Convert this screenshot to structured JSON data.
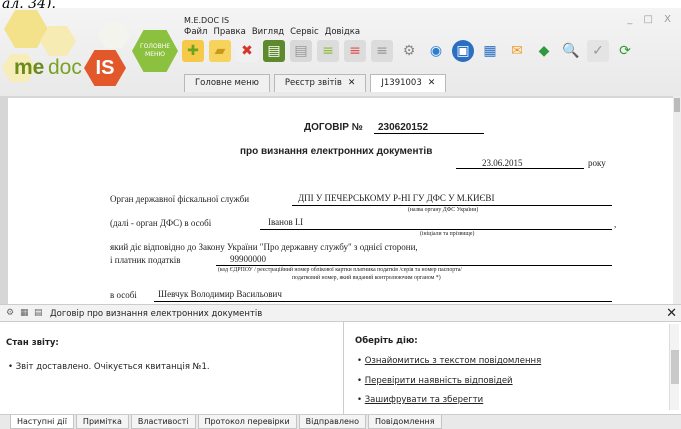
{
  "caption": "ал. 34).",
  "app": {
    "title": "M.E.DOC IS",
    "logo": {
      "me": "me",
      "doc": "doc",
      "is": "IS",
      "menu_badge": "ГОЛОВНЕ МЕНЮ"
    },
    "window_controls": "_ □ X"
  },
  "menubar": [
    "Файл",
    "Правка",
    "Вигляд",
    "Сервіс",
    "Довідка"
  ],
  "toolbar_icons": [
    "new-doc-icon",
    "open-folder-icon",
    "delete-doc-icon",
    "save-icon",
    "doc-gray-icon",
    "add-doc-icon",
    "remove-doc-icon",
    "cancel-doc-icon",
    "gear-icon",
    "share-icon",
    "archive-icon",
    "print-icon",
    "envelope-icon",
    "sign-icon",
    "search-doc-icon",
    "check-doc-icon",
    "refresh-icon"
  ],
  "tabs": [
    {
      "label": "Головне меню",
      "closable": false,
      "active": false
    },
    {
      "label": "Реєстр звітів",
      "closable": true,
      "active": false
    },
    {
      "label": "J1391003",
      "closable": true,
      "active": true
    }
  ],
  "document": {
    "title": "ДОГОВІР №",
    "number": "230620152",
    "subtitle": "про визнання електронних документів",
    "date": "23.06.2015",
    "year_suffix": "року",
    "organ_label": "Орган державної фіскальної служби",
    "organ_value": "ДПІ У ПЕЧЕРСЬКОМУ Р-НІ ГУ  ДФС У М.КИЄВІ",
    "organ_hint": "(назва органу ДФС України)",
    "person_label": "(далі - орган ДФС) в особі",
    "person_value": "Іванов І.І",
    "person_hint": "(ініціали та прізвище)",
    "acting_text": "який діє відповідно до Закону України \"Про державну службу\" з однієї сторони,",
    "payer_label": "і платник податків",
    "payer_value": "99900000",
    "payer_hint1": "(код ЄДРПОУ / реєстраційний номер облікової картки  платника  податків /серія та номер паспорта/",
    "payer_hint2": "податковий номер, який виданий контролюючим органом *)",
    "rep_label": "в особі",
    "rep_value": "Шевчук Володимир Васильович"
  },
  "info_bar": {
    "title": "Договір про визнання електронних документів"
  },
  "status": {
    "heading": "Стан звіту:",
    "items": [
      "Звіт доставлено. Очікується квитанція №1."
    ]
  },
  "actions": {
    "heading": "Оберіть дію:",
    "items": [
      "Ознайомитись з текстом повідомлення",
      "Перевірити наявність відповідей",
      "Зашифрувати та зберегти"
    ]
  },
  "bottom_tabs": [
    "Наступні дії",
    "Примітка",
    "Властивості",
    "Протокол перевірки",
    "Відправлено",
    "Повідомлення"
  ]
}
